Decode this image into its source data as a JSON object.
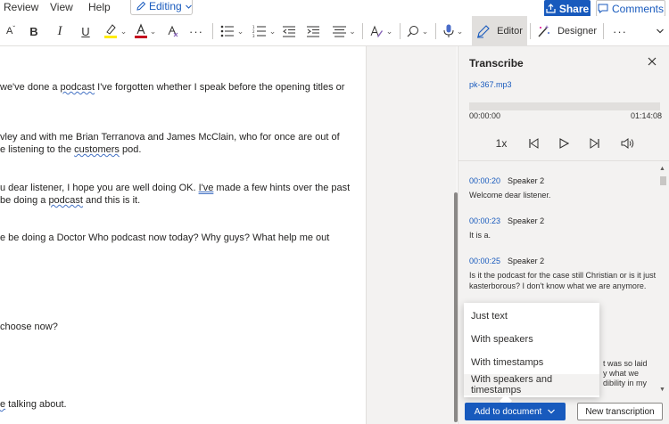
{
  "menu": {
    "review": "Review",
    "view": "View",
    "help": "Help",
    "editing": "Editing",
    "share": "Share",
    "comments": "Comments"
  },
  "ribbon": {
    "editor": "Editor",
    "designer": "Designer",
    "font_size_glyph": "A",
    "bold": "B",
    "italic": "I",
    "underline": "U",
    "more": "···",
    "highlight_color": "#ffeb00",
    "font_color": "#c50f1f"
  },
  "document": {
    "lines": [
      {
        "pre": "we've done a ",
        "sq": "podcast",
        "post": " I've forgotten whether I speak before the opening titles or"
      },
      {
        "pre": "vley and with me Brian Terranova and James McClain, who for once are out of",
        "sq": "",
        "post": ""
      },
      {
        "pre": "e listening to the ",
        "sq": "customers",
        "post": " pod."
      },
      {
        "pre": "u dear listener, I hope you are well doing OK. ",
        "sq": "I've",
        "post": " made a few hints over the past"
      },
      {
        "pre": "be doing a ",
        "sq": "podcast",
        "post": " and this is it."
      },
      {
        "pre": "e be doing a Doctor Who podcast now today? Why guys? What help me out",
        "sq": "",
        "post": ""
      },
      {
        "pre": "choose now?",
        "sq": "",
        "post": ""
      },
      {
        "pre": "",
        "sq": "e",
        "post": " talking about."
      }
    ]
  },
  "pane": {
    "title": "Transcribe",
    "file": "pk-367.mp3",
    "time_start": "00:00:00",
    "time_end": "01:14:08",
    "speed": "1x",
    "progress": 0,
    "segments": [
      {
        "time": "00:00:20",
        "speaker": "Speaker 2",
        "text": "Welcome dear listener."
      },
      {
        "time": "00:00:23",
        "speaker": "Speaker 2",
        "text": "It is a."
      },
      {
        "time": "00:00:25",
        "speaker": "Speaker 2",
        "text": "Is it the podcast for the case still Christian or is it just kasterborous? I don't know what we are anymore."
      }
    ],
    "behind": [
      "t was so laid",
      "y what we",
      "dibility in my"
    ]
  },
  "dropdown": {
    "items": [
      "Just text",
      "With speakers",
      "With timestamps",
      "With speakers and timestamps"
    ]
  },
  "buttons": {
    "add": "Add to document",
    "new": "New transcription"
  }
}
